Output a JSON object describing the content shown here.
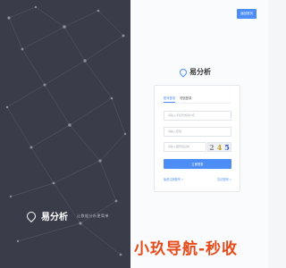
{
  "header": {
    "back_label": "返回首页"
  },
  "brand": {
    "left_name": "易分析",
    "left_slogan": "让数据分析更简单",
    "app_name": "易分析"
  },
  "login": {
    "tabs": [
      {
        "label": "账号登录",
        "active": true
      },
      {
        "label": "短信登录",
        "active": false
      }
    ],
    "fields": {
      "account_placeholder": "请输入手机号或用户名",
      "password_placeholder": "请输入密码",
      "captcha_placeholder": "请输入图形验证码"
    },
    "captcha_chars": [
      "2",
      "4",
      "5"
    ],
    "submit_label": "立即登录",
    "register_link": "免费注册账号 >",
    "forgot_link": "忘记密码 >"
  },
  "watermark": {
    "text": "小玖导航-秒收"
  },
  "colors": {
    "accent": "#4c8df6",
    "left_bg": "#3a3d49",
    "watermark": "#e64a19"
  }
}
